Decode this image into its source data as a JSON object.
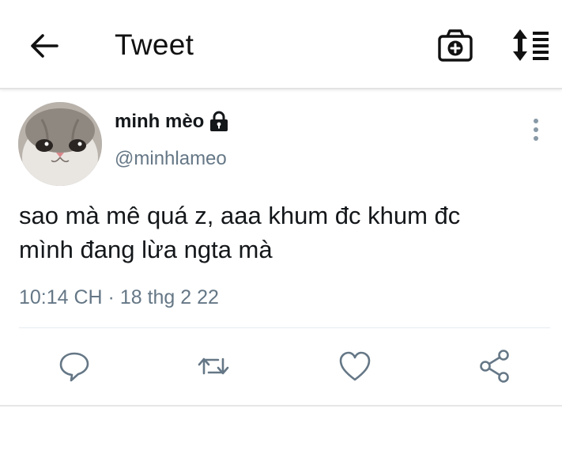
{
  "header": {
    "title": "Tweet",
    "icons": {
      "back": "arrow-left-icon",
      "camera": "camera-plus-icon",
      "sort": "sort-lines-icon"
    }
  },
  "tweet": {
    "display_name": "minh mèo",
    "handle": "@minhlameo",
    "protected": true,
    "text_line1": "sao mà mê quá z, aaa khum đc khum đc",
    "text_line2": "mình đang lừa ngta mà",
    "timestamp": "10:14 CH · 18 thg 2 22"
  },
  "actions": [
    "reply-icon",
    "retweet-icon",
    "like-icon",
    "share-icon"
  ],
  "colors": {
    "text": "#14171a",
    "secondary": "#657786",
    "divider": "#e6ecf0"
  }
}
